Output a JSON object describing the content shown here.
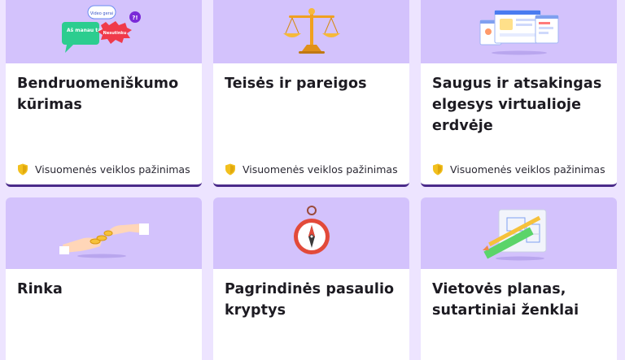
{
  "cards": [
    {
      "title": "Bendruomeniškumo kūrimas",
      "icon": "speech-bubbles-image",
      "tag": "Visuomenės veiklos pažinimas"
    },
    {
      "title": "Teisės ir pareigos",
      "icon": "scales-image",
      "tag": "Visuomenės veiklos pažinimas"
    },
    {
      "title": "Saugus ir atsakingas elgesys virtualioje erdvėje",
      "icon": "browser-windows-image",
      "tag": "Visuomenės veiklos pažinimas"
    },
    {
      "title": "Rinka",
      "icon": "coins-hands-image"
    },
    {
      "title": "Pagrindinės pasaulio kryptys",
      "icon": "compass-image"
    },
    {
      "title": "Vietovės planas, sutartiniai ženklai",
      "icon": "blueprint-ruler-image"
    }
  ],
  "illustration_text": {
    "bubble_small": "Video gerai",
    "bubble_green": "Aš manau taip...",
    "bubble_red": "Nesutinku",
    "bubble_purple": "?!"
  },
  "colors": {
    "background": "#ede4ff",
    "thumb": "#d3c2fc",
    "shield": "#f2c01e",
    "card_border": "#4a2a8a"
  }
}
